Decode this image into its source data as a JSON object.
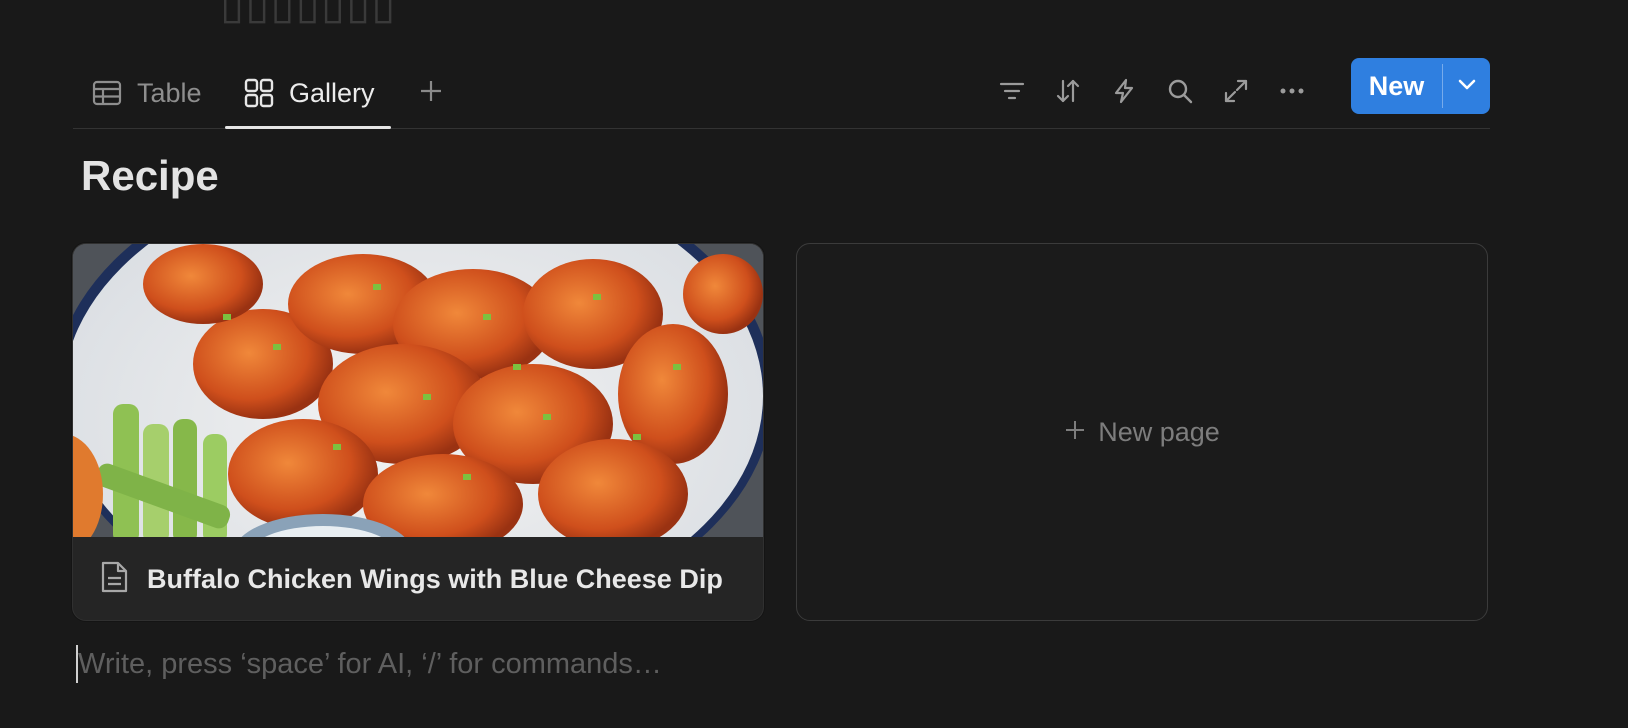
{
  "tabs": [
    {
      "label": "Table",
      "icon": "table-icon",
      "active": false
    },
    {
      "label": "Gallery",
      "icon": "gallery-icon",
      "active": true
    }
  ],
  "toolbar": {
    "tools": [
      "filter-icon",
      "sort-icon",
      "automation-bolt-icon",
      "search-icon",
      "expand-icon",
      "more-icon"
    ],
    "new_label": "New"
  },
  "page": {
    "title": "Recipe"
  },
  "gallery": {
    "cards": [
      {
        "title": "Buffalo Chicken Wings with Blue Cheese Dip",
        "icon": "page-icon",
        "cover": "buffalo-wings-photo"
      }
    ],
    "new_page_label": "New page"
  },
  "editor": {
    "placeholder": "Write, press ‘space’ for AI, ‘/’ for commands…"
  },
  "colors": {
    "background": "#191919",
    "accent": "#2f7fe0",
    "card": "#252525"
  }
}
